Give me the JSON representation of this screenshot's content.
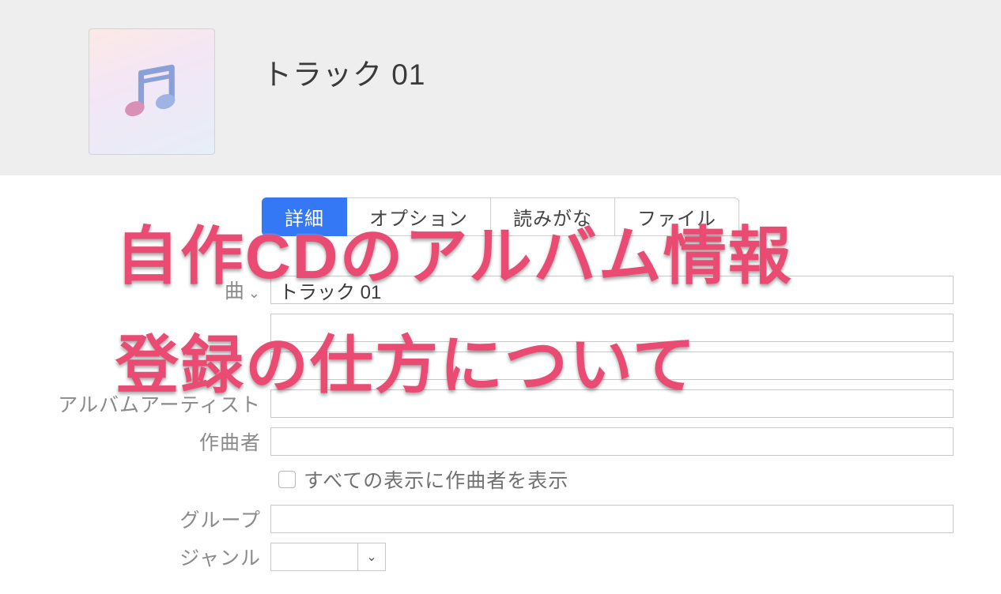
{
  "header": {
    "track_title": "トラック 01"
  },
  "tabs": {
    "details": "詳細",
    "option": "オプション",
    "reading": "読みがな",
    "file": "ファイル"
  },
  "form": {
    "song_label": "曲",
    "song_value": "トラック 01",
    "artist_label": "",
    "artist_value": "",
    "album_label": "",
    "album_value": "",
    "album_artist_label": "アルバムアーティスト",
    "album_artist_value": "",
    "composer_label": "作曲者",
    "composer_value": "",
    "show_composer_label": "すべての表示に作曲者を表示",
    "group_label": "グループ",
    "group_value": "",
    "genre_label": "ジャンル",
    "genre_value": ""
  },
  "overlay": {
    "line1": "自作CDのアルバム情報",
    "line2": "登録の仕方について"
  }
}
